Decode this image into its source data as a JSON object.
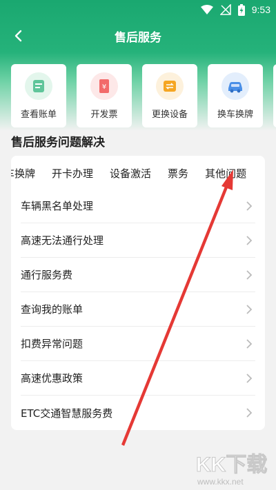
{
  "status_bar": {
    "time": "9:53"
  },
  "nav": {
    "title": "售后服务"
  },
  "quick_actions": [
    {
      "label": "查看账单",
      "icon": "bill-icon",
      "color": "#5fc59a"
    },
    {
      "label": "开发票",
      "icon": "invoice-icon",
      "color": "#f26a6a"
    },
    {
      "label": "更换设备",
      "icon": "swap-device-icon",
      "color": "#f5a623"
    },
    {
      "label": "换车换牌",
      "icon": "car-icon",
      "color": "#4a8fe7"
    }
  ],
  "section": {
    "title": "售后服务问题解决"
  },
  "tabs": [
    "车换牌",
    "开卡办理",
    "设备激活",
    "票务",
    "其他问题"
  ],
  "list_items": [
    "车辆黑名单处理",
    "高速无法通行处理",
    "通行服务费",
    "查询我的账单",
    "扣费异常问题",
    "高速优惠政策",
    "ETC交通智慧服务费"
  ],
  "watermark": {
    "brand": "KK下载",
    "url": "www.kkx.net"
  },
  "colors": {
    "primary": "#1aa870",
    "annotation_arrow": "#e53935"
  }
}
